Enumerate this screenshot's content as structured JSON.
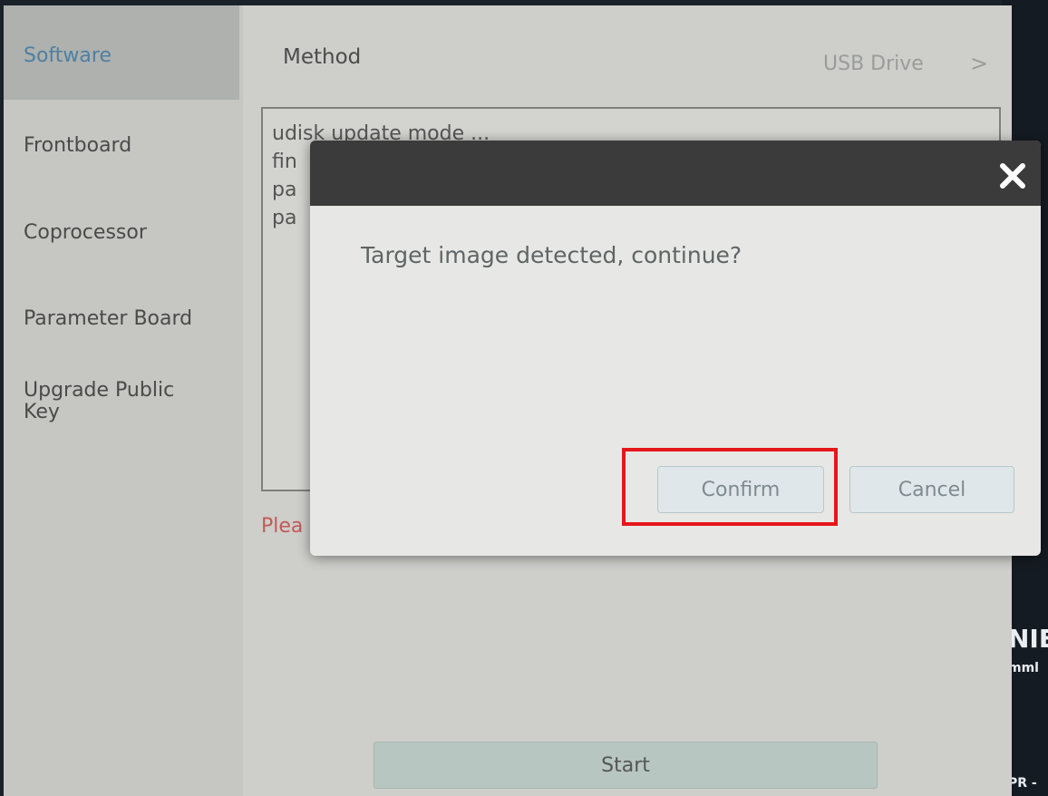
{
  "sidebar": {
    "items": [
      {
        "label": "Software",
        "active": true
      },
      {
        "label": "Frontboard"
      },
      {
        "label": "Coprocessor"
      },
      {
        "label": "Parameter Board"
      },
      {
        "label": "Upgrade Public Key"
      }
    ]
  },
  "main": {
    "method_label": "Method",
    "method_value": "USB Drive",
    "chevron": ">",
    "log_lines": [
      "udisk update mode ...",
      "fin",
      "pa",
      "pa"
    ],
    "warning_text": "Plea",
    "start_label": "Start"
  },
  "dialog": {
    "close_icon": "close-icon",
    "message": "Target image detected, continue?",
    "confirm_label": "Confirm",
    "cancel_label": "Cancel"
  },
  "right_edge": {
    "big_text": "NIE",
    "small_text": "mml",
    "bottom_text": "PR -"
  },
  "colors": {
    "highlight": "#e6161a",
    "active_sidebar_text": "#4f7fa2",
    "warning_text": "#bf5b58",
    "dialog_header": "#3b3b3b"
  }
}
